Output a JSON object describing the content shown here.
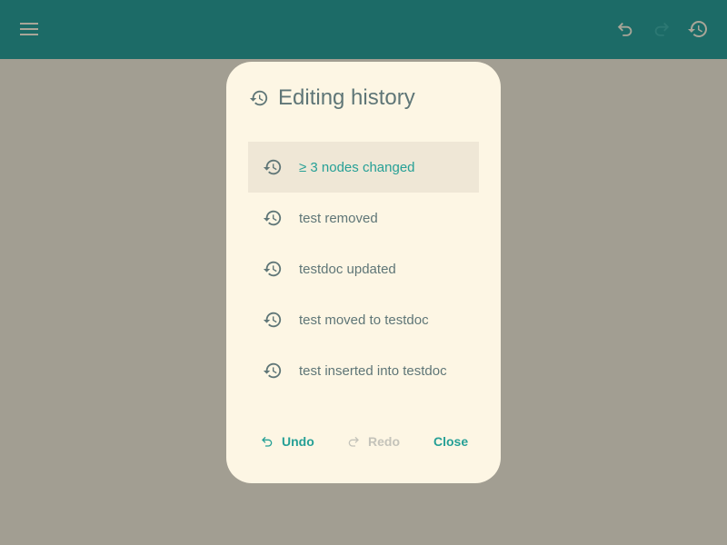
{
  "colors": {
    "topbar": "#1c6b67",
    "backdrop": "#a29e92",
    "dialog": "#fdf6e4",
    "accent": "#26a096",
    "text": "#5f7677",
    "disabled": "#c4c3ba"
  },
  "topbar": {
    "menu_icon": "menu-icon",
    "undo_icon": "undo-icon",
    "redo_icon": "redo-icon",
    "history_icon": "history-icon"
  },
  "dialog": {
    "title": "Editing history",
    "items": [
      {
        "label": "≥ 3 nodes changed",
        "active": true
      },
      {
        "label": "test removed"
      },
      {
        "label": "testdoc updated"
      },
      {
        "label": "test moved to testdoc"
      },
      {
        "label": "test inserted into testdoc"
      }
    ],
    "undo_label": "Undo",
    "redo_label": "Redo",
    "redo_disabled": true,
    "close_label": "Close"
  }
}
